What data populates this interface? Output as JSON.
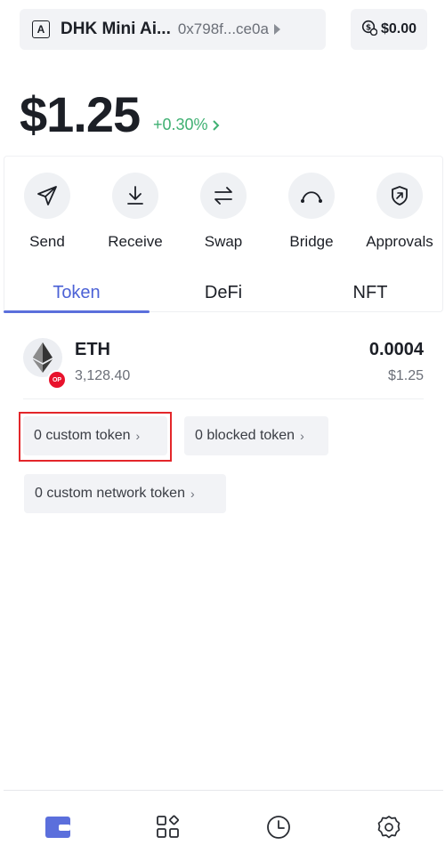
{
  "header": {
    "account_letter": "A",
    "account_name": "DHK Mini Ai...",
    "account_address": "0x798f...ce0a",
    "balance_pill": "$0.00"
  },
  "summary": {
    "total_balance": "$1.25",
    "change": "+0.30%",
    "change_color": "#3fb072"
  },
  "actions": [
    {
      "label": "Send",
      "icon": "send-icon"
    },
    {
      "label": "Receive",
      "icon": "receive-icon"
    },
    {
      "label": "Swap",
      "icon": "swap-icon"
    },
    {
      "label": "Bridge",
      "icon": "bridge-icon"
    },
    {
      "label": "Approvals",
      "icon": "approvals-icon"
    }
  ],
  "tabs": [
    {
      "label": "Token",
      "active": true
    },
    {
      "label": "DeFi",
      "active": false
    },
    {
      "label": "NFT",
      "active": false
    }
  ],
  "tokens": [
    {
      "symbol": "ETH",
      "price": "3,128.40",
      "amount": "0.0004",
      "value": "$1.25",
      "chain_badge": "OP",
      "icon": "eth-icon"
    }
  ],
  "token_filters": {
    "custom": "0 custom token",
    "blocked": "0 blocked token",
    "network": "0 custom network token"
  },
  "bottom_nav": [
    {
      "name": "wallet",
      "icon": "wallet-icon",
      "active": true
    },
    {
      "name": "apps",
      "icon": "apps-icon",
      "active": false
    },
    {
      "name": "history",
      "icon": "history-icon",
      "active": false
    },
    {
      "name": "settings",
      "icon": "settings-icon",
      "active": false
    }
  ],
  "colors": {
    "accent": "#4c62d6",
    "positive": "#3fb072",
    "highlight_border": "#e3262a",
    "op_badge": "#e8132c"
  }
}
